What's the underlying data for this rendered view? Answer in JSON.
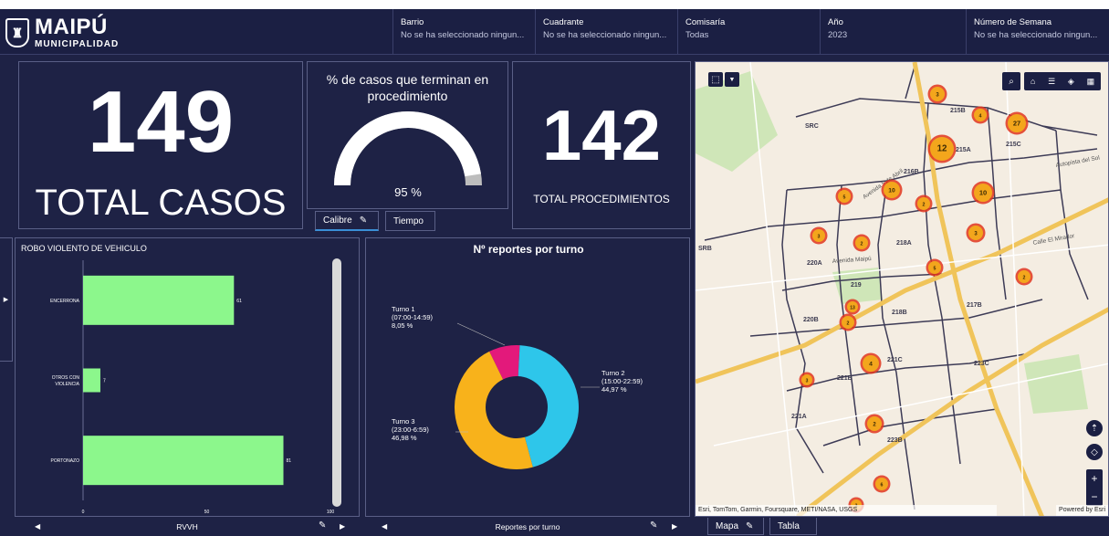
{
  "header": {
    "logo_name": "MAIPÚ",
    "logo_sub": "MUNICIPALIDAD",
    "filters": [
      {
        "label": "Barrio",
        "value": "No se ha seleccionado ningun..."
      },
      {
        "label": "Cuadrante",
        "value": "No se ha seleccionado ningun..."
      },
      {
        "label": "Comisaría",
        "value": "Todas"
      },
      {
        "label": "Año",
        "value": "2023"
      },
      {
        "label": "Número de Semana",
        "value": "No se ha seleccionado ningun..."
      }
    ]
  },
  "kpi_total": {
    "value": "149",
    "label": "TOTAL CASOS"
  },
  "gauge": {
    "title_line1": "% de casos que terminan en",
    "title_line2": "procedimiento",
    "value_text": "95 %",
    "value": 0.95,
    "tabs": [
      "Calibre",
      "Tiempo"
    ]
  },
  "kpi_proc": {
    "value": "142",
    "label": "TOTAL PROCEDIMIENTOS"
  },
  "bar_panel": {
    "title": "ROBO VIOLENTO DE VEHICULO",
    "footer": "RVVH"
  },
  "donut_panel": {
    "title": "Nº reportes por turno",
    "footer": "Reportes por turno",
    "labels": [
      {
        "line1": "Turno 1",
        "line2": "(07:00-14:59)",
        "line3": "8,05 %"
      },
      {
        "line1": "Turno 2",
        "line2": "(15:00-22:59)",
        "line3": "44,97 %"
      },
      {
        "line1": "Turno 3",
        "line2": "(23:00-6:59)",
        "line3": "46,98 %"
      }
    ]
  },
  "map_panel": {
    "attribution_left": "Esri, TomTom, Garmin, Foursquare, METI/NASA, USGS",
    "attribution_right": "Powered by Esri",
    "tabs": [
      "Mapa",
      "Tabla"
    ],
    "labels": [
      "215B",
      "SRC",
      "215A",
      "215C",
      "216B",
      "218A",
      "220A",
      "219",
      "218B",
      "220B",
      "217B",
      "221C",
      "223C",
      "221B",
      "221A",
      "223B",
      "SRB"
    ],
    "roads": [
      "Autopista del Sol",
      "Avenida Maipú",
      "Calle El Mirador",
      "Avenida 5 de Abril"
    ],
    "cluster_counts": [
      "3",
      "4",
      "12",
      "27",
      "10",
      "10",
      "5",
      "2",
      "3",
      "3",
      "2",
      "5",
      "2",
      "13",
      "2",
      "4",
      "3",
      "2",
      "6",
      "3"
    ],
    "colors": {
      "map_bg": "#f4ede2",
      "cluster": "#f3a61c",
      "cluster_ring": "#e0351d"
    }
  },
  "chart_data": [
    {
      "type": "bar",
      "orientation": "horizontal",
      "title": "ROBO VIOLENTO DE VEHICULO",
      "categories": [
        "ENCERRONA",
        "OTROS CON VIOLENCIA",
        "PORTONAZO"
      ],
      "category_lines": [
        [
          "ENCERRONA"
        ],
        [
          "OTROS CON",
          "VIOLENCIA"
        ],
        [
          "PORTONAZO"
        ]
      ],
      "values": [
        61,
        7,
        81
      ],
      "xlim": [
        0,
        100
      ],
      "xticks": [
        0,
        50,
        100
      ],
      "color": "#8cf78c"
    },
    {
      "type": "pie",
      "donut": true,
      "title": "Nº reportes por turno",
      "categories": [
        "Turno 1 (07:00-14:59)",
        "Turno 2 (15:00-22:59)",
        "Turno 3 (23:00-6:59)"
      ],
      "values": [
        8.05,
        44.97,
        46.98
      ],
      "colors": [
        "#e3197b",
        "#2ec6ea",
        "#f8b21b"
      ]
    }
  ]
}
